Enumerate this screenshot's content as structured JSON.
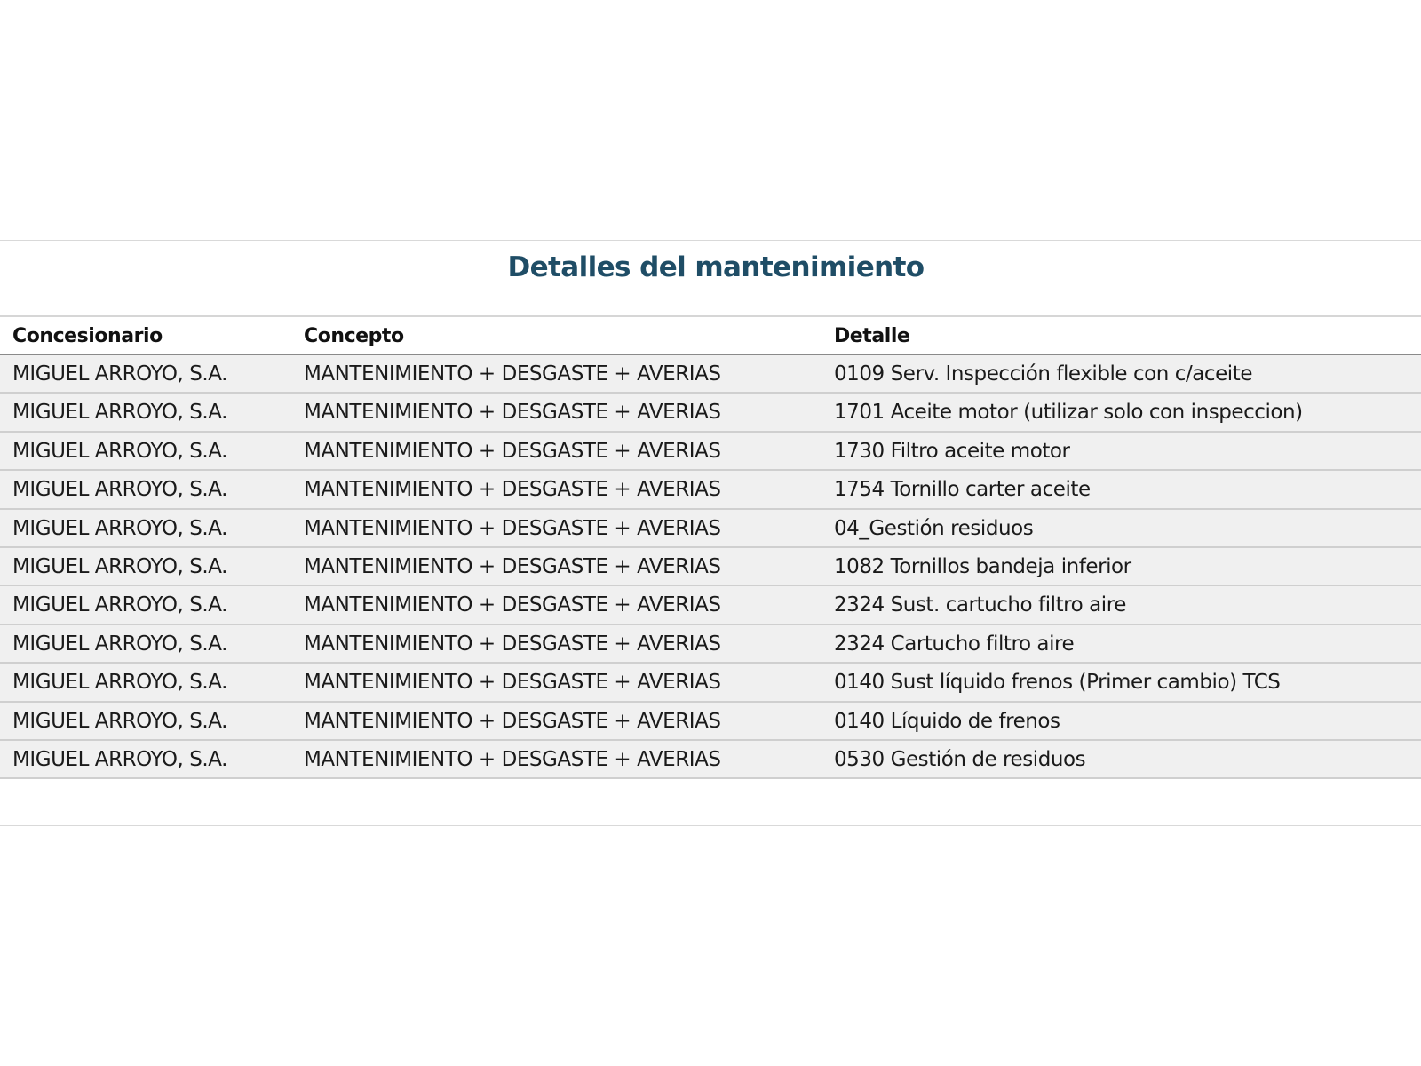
{
  "title": "Detalles del mantenimiento",
  "table": {
    "headers": [
      "Concesionario",
      "Concepto",
      "Detalle"
    ],
    "rows": [
      [
        "MIGUEL ARROYO, S.A.",
        "MANTENIMIENTO + DESGASTE + AVERIAS",
        "0109 Serv. Inspección flexible con c/aceite"
      ],
      [
        "MIGUEL ARROYO, S.A.",
        "MANTENIMIENTO + DESGASTE + AVERIAS",
        "1701 Aceite motor (utilizar solo con inspeccion)"
      ],
      [
        "MIGUEL ARROYO, S.A.",
        "MANTENIMIENTO + DESGASTE + AVERIAS",
        "1730 Filtro aceite motor"
      ],
      [
        "MIGUEL ARROYO, S.A.",
        "MANTENIMIENTO + DESGASTE + AVERIAS",
        "1754 Tornillo carter aceite"
      ],
      [
        "MIGUEL ARROYO, S.A.",
        "MANTENIMIENTO + DESGASTE + AVERIAS",
        "04_Gestión residuos"
      ],
      [
        "MIGUEL ARROYO, S.A.",
        "MANTENIMIENTO + DESGASTE + AVERIAS",
        "1082 Tornillos bandeja inferior"
      ],
      [
        "MIGUEL ARROYO, S.A.",
        "MANTENIMIENTO + DESGASTE + AVERIAS",
        "2324 Sust. cartucho filtro aire"
      ],
      [
        "MIGUEL ARROYO, S.A.",
        "MANTENIMIENTO + DESGASTE + AVERIAS",
        "2324 Cartucho filtro aire"
      ],
      [
        "MIGUEL ARROYO, S.A.",
        "MANTENIMIENTO + DESGASTE + AVERIAS",
        "0140 Sust líquido frenos (Primer cambio) TCS"
      ],
      [
        "MIGUEL ARROYO, S.A.",
        "MANTENIMIENTO + DESGASTE + AVERIAS",
        "0140 Líquido de frenos"
      ],
      [
        "MIGUEL ARROYO, S.A.",
        "MANTENIMIENTO + DESGASTE + AVERIAS",
        "0530 Gestión de residuos"
      ]
    ]
  },
  "colors": {
    "title": "#1f4d66",
    "row_background": "#f0f0f0",
    "row_divider": "#cfcfcf",
    "header_divider": "#8a8a8a"
  }
}
